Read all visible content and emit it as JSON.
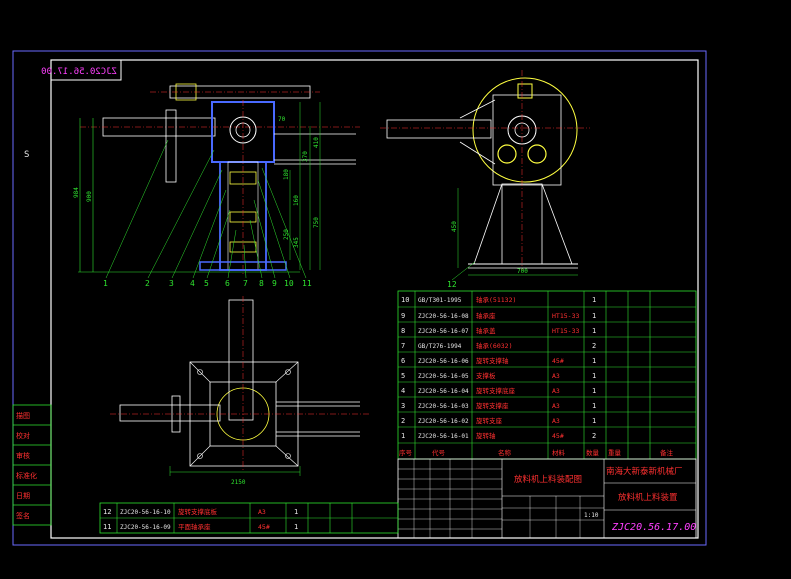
{
  "drawing": {
    "drawing_number_top": "ZJC20.56.17.00",
    "side_mark": "S",
    "drawing_number_bottom": "ZJC20.56.17.00",
    "title_left": "放料机上料装配图",
    "company": "南海大新泰新机械厂",
    "title_right": "放料机上料装置",
    "scale": "1:10",
    "colors": {
      "background": "#000000",
      "frame": "#6a6aff",
      "border": "#ffffff",
      "table": "#2fe32f",
      "text_red": "#ff3030",
      "part_blue": "#4a6aff",
      "part_yellow": "#ffff40",
      "dimension": "#2fe32f"
    }
  },
  "front_view": {
    "dimensions": [
      "984",
      "900",
      "370",
      "410",
      "750",
      "180",
      "160",
      "250",
      "345",
      "70"
    ],
    "callouts": [
      "1",
      "2",
      "3",
      "4",
      "5",
      "6",
      "7",
      "8",
      "9",
      "10",
      "11"
    ]
  },
  "side_view": {
    "dimensions": [
      "450",
      "700"
    ],
    "callout": "12"
  },
  "plan_view": {
    "dimension": "2150"
  },
  "parts_table": {
    "headers": [
      "序号",
      "代号",
      "名称",
      "数量",
      "材料",
      "重量",
      "备注"
    ],
    "rows": [
      {
        "no": "10",
        "code": "GB/T301-1995",
        "name": "轴承(51132)",
        "material": "",
        "qty": "1"
      },
      {
        "no": "9",
        "code": "ZJC20-56-16-08",
        "name": "轴承座",
        "material": "HT15-33",
        "qty": "1"
      },
      {
        "no": "8",
        "code": "ZJC20-56-16-07",
        "name": "轴承盖",
        "material": "HT15-33",
        "qty": "1"
      },
      {
        "no": "7",
        "code": "GB/T276-1994",
        "name": "轴承(6032)",
        "material": "",
        "qty": "2"
      },
      {
        "no": "6",
        "code": "ZJC20-56-16-06",
        "name": "旋转支撑轴",
        "material": "45#",
        "qty": "1"
      },
      {
        "no": "5",
        "code": "ZJC20-56-16-05",
        "name": "支撑板",
        "material": "A3",
        "qty": "1"
      },
      {
        "no": "4",
        "code": "ZJC20-56-16-04",
        "name": "旋转支撑底座",
        "material": "A3",
        "qty": "1"
      },
      {
        "no": "3",
        "code": "ZJC20-56-16-03",
        "name": "旋转支撑座",
        "material": "A3",
        "qty": "1"
      },
      {
        "no": "2",
        "code": "ZJC20-56-16-02",
        "name": "旋转支座",
        "material": "A3",
        "qty": "1"
      },
      {
        "no": "1",
        "code": "ZJC20-56-16-01",
        "name": "旋转轴",
        "material": "45#",
        "qty": "2"
      }
    ]
  },
  "bottom_table": {
    "rows": [
      {
        "no": "12",
        "code": "ZJC20-56-16-10",
        "name": "旋转支撑底板",
        "material": "A3",
        "qty": "1"
      },
      {
        "no": "11",
        "code": "ZJC20-56-16-09",
        "name": "平面轴承座",
        "material": "45#",
        "qty": "1"
      }
    ]
  },
  "left_strip": [
    "描图",
    "校对",
    "审核",
    "标准化",
    "日期",
    "签名"
  ]
}
